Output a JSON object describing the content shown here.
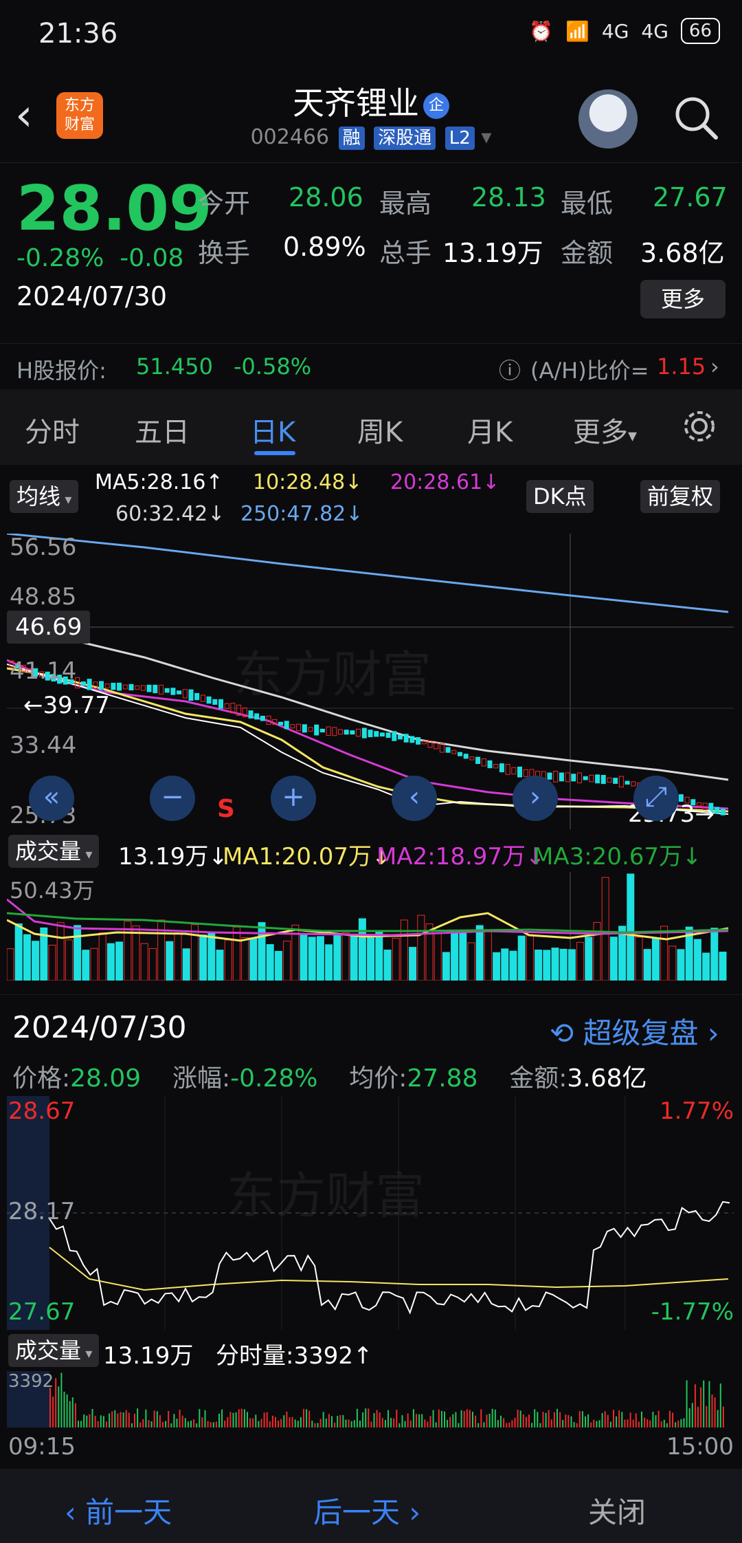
{
  "status": {
    "time": "21:36",
    "net1": "4G",
    "net2": "4G",
    "battery": "66"
  },
  "header": {
    "logo_line1": "东方",
    "logo_line2": "财富",
    "stock_name": "天齐锂业",
    "badge": "企",
    "code": "002466",
    "tags": [
      "融",
      "深股通",
      "L2"
    ]
  },
  "quote": {
    "price": "28.09",
    "change_pct": "-0.28%",
    "change": "-0.08",
    "date": "2024/07/30",
    "open_label": "今开",
    "open": "28.06",
    "high_label": "最高",
    "high": "28.13",
    "low_label": "最低",
    "low": "27.67",
    "turnover_label": "换手",
    "turnover": "0.89%",
    "volume_label": "总手",
    "volume": "13.19万",
    "amount_label": "金额",
    "amount": "3.68亿",
    "more": "更多",
    "h_label": "H股报价:",
    "h_price": "51.450",
    "h_change": "-0.58%",
    "ah_label": "(A/H)比价=",
    "ah_value": "1.15"
  },
  "tabs": [
    "分时",
    "五日",
    "日K",
    "周K",
    "月K",
    "更多"
  ],
  "active_tab": "日K",
  "ma_legend": {
    "selector": "均线",
    "ma5": "MA5:28.16↑",
    "ma10": "10:28.48↓",
    "ma20": "20:28.61↓",
    "ma60": "60:32.42↓",
    "ma250": "250:47.82↓",
    "dk": "DK点",
    "adjust": "前复权"
  },
  "colors": {
    "green": "#22c55e",
    "red": "#ef2a2a",
    "ma5": "#ffffff",
    "ma10": "#f5e663",
    "ma20": "#d63ad6",
    "ma60": "#c8c8c8",
    "ma250": "#6aa8ee",
    "accent": "#3b82f6"
  },
  "kchart": {
    "y_labels": [
      "56.56",
      "48.85",
      "41.14",
      "33.44",
      "25.73"
    ],
    "crosshair_price": "46.69",
    "marker_high": "39.77",
    "marker_low": "25.73",
    "sell_marker": "S"
  },
  "volume_legend": {
    "selector": "成交量",
    "value": "13.19万↓",
    "ma1": "MA1:20.07万↓",
    "ma2": "MA2:18.97万↓",
    "ma3": "MA3:20.67万↓",
    "max_label": "50.43万"
  },
  "review": {
    "date": "2024/07/30",
    "super_review": "超级复盘",
    "price_label": "价格:",
    "price": "28.09",
    "chg_label": "涨幅:",
    "chg": "-0.28%",
    "avg_label": "均价:",
    "avg": "27.88",
    "amt_label": "金额:",
    "amt": "3.68亿"
  },
  "intraday": {
    "top_left": "28.67",
    "mid_left": "28.17",
    "bottom_left": "27.67",
    "top_right": "1.77%",
    "bottom_right": "-1.77%"
  },
  "intraday_volume": {
    "selector": "成交量",
    "total": "13.19万",
    "tick_label": "分时量:3392↑",
    "max_label": "3392",
    "time_start": "09:15",
    "time_end": "15:00"
  },
  "nav": {
    "prev": "前一天",
    "next": "后一天",
    "close": "关闭"
  }
}
